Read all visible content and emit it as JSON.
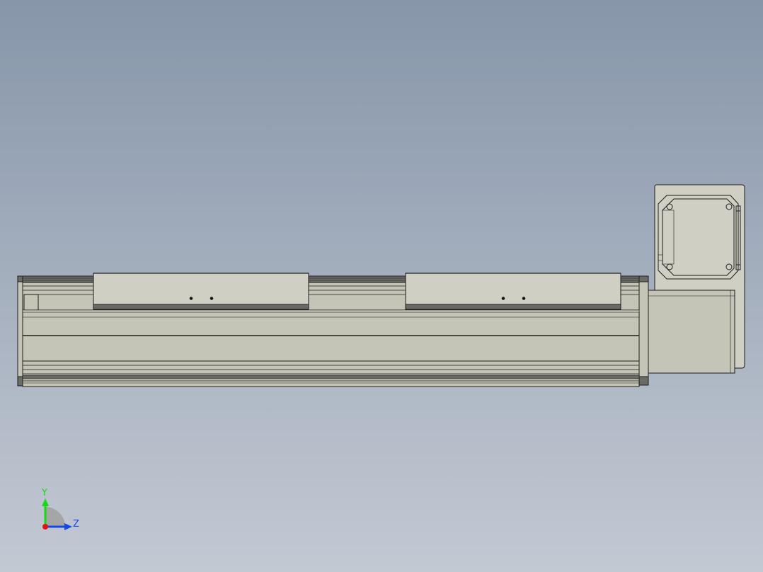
{
  "viewport": {
    "background_top": "#8796aa",
    "background_bottom": "#c3c9d3"
  },
  "model": {
    "part_fill": "#c4c4b7",
    "part_fill_light": "#cfcfc4",
    "edge_color": "#1e1e1e",
    "dark_face": "#6a6a66",
    "carriage_count": 2,
    "motor_bolt_holes": 4
  },
  "triad": {
    "y_label": "Y",
    "z_label": "Z",
    "y_color": "#16d816",
    "z_color": "#1448e0",
    "x_color": "#e01414"
  }
}
